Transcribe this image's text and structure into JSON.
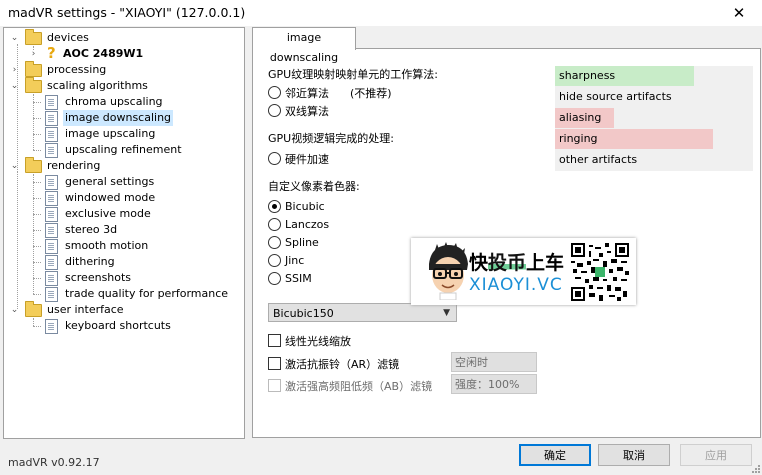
{
  "window": {
    "title": "madVR settings - \"XIAOYI\" (127.0.0.1)",
    "close_glyph": "✕"
  },
  "tree": {
    "devices": "devices",
    "aoc": "AOC 2489W1",
    "processing": "processing",
    "scaling": "scaling algorithms",
    "chroma": "chroma upscaling",
    "downscaling": "image downscaling",
    "upscaling": "image upscaling",
    "refinement": "upscaling refinement",
    "rendering": "rendering",
    "general": "general settings",
    "windowed": "windowed mode",
    "exclusive": "exclusive mode",
    "stereo": "stereo 3d",
    "smooth": "smooth motion",
    "dithering": "dithering",
    "screenshots": "screenshots",
    "trade": "trade quality for performance",
    "ui": "user interface",
    "shortcuts": "keyboard shortcuts"
  },
  "tab": {
    "label": "image downscaling"
  },
  "panel": {
    "gpu_texture_heading": "GPU纹理映射映射单元的工作算法:",
    "nearest": "邻近算法",
    "not_recommended": "(不推荐)",
    "bilinear": "双线算法",
    "gpu_video_heading": "GPU视频逻辑完成的处理:",
    "hardware_accel": "硬件加速",
    "custom_shader_heading": "自定义像素着色器:",
    "shaders": [
      "Bicubic",
      "Lanczos",
      "Spline",
      "Jinc",
      "SSIM"
    ],
    "selected_shader": "Bicubic",
    "combo_value": "Bicubic150",
    "linear_light": "线性光线缩放",
    "anti_ringing": "激活抗振铃（AR）滤镜",
    "anti_ringing_value": "空闲时",
    "anti_bloating": "激活强高频阻低频（AB）滤镜",
    "anti_bloating_value": "强度：100%"
  },
  "artifacts": [
    {
      "label": "sharpness",
      "level": 0.7,
      "color": "#c8ecc8"
    },
    {
      "label": "hide source artifacts",
      "level": 0.0,
      "color": "#c8ecc8"
    },
    {
      "label": "aliasing",
      "level": 0.3,
      "color": "#f2c8c8"
    },
    {
      "label": "ringing",
      "level": 0.8,
      "color": "#f2c8c8"
    },
    {
      "label": "other artifacts",
      "level": 0.0,
      "color": "#f2c8c8"
    }
  ],
  "watermark": {
    "cn_a": "快",
    "cn_b": "投币",
    "cn_c": "上车",
    "en": "XIAOYI.VC"
  },
  "footer": {
    "version": "madVR v0.92.17",
    "ok": "确定",
    "cancel": "取消",
    "apply": "应用"
  }
}
